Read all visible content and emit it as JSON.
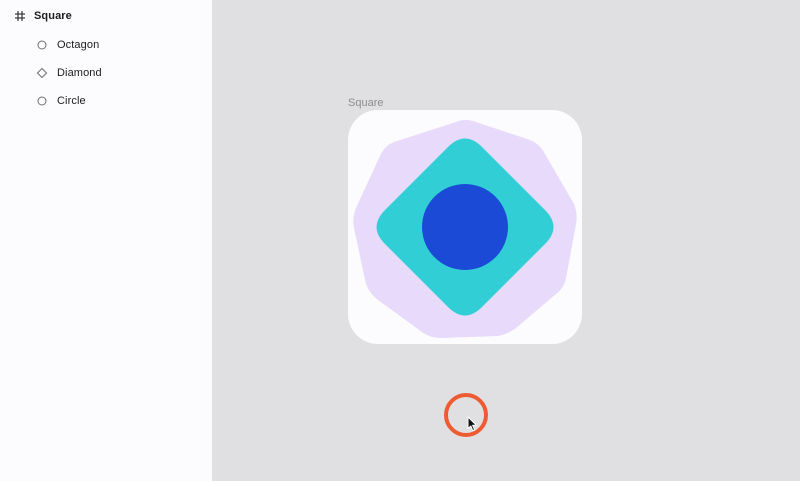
{
  "layers": {
    "frame": {
      "label": "Square",
      "icon": "hash-icon"
    },
    "children": [
      {
        "label": "Octagon",
        "icon": "circle-outline-icon"
      },
      {
        "label": "Diamond",
        "icon": "diamond-outline-icon"
      },
      {
        "label": "Circle",
        "icon": "circle-outline-icon"
      }
    ]
  },
  "canvas": {
    "frame_title": "Square",
    "colors": {
      "background": "#e0dfe1",
      "frame_fill": "#fcfbfd",
      "octagon": "#e7dafb",
      "diamond": "#31cfd5",
      "circle": "#1b4bd6",
      "click_indicator": "#ee5b33"
    }
  }
}
